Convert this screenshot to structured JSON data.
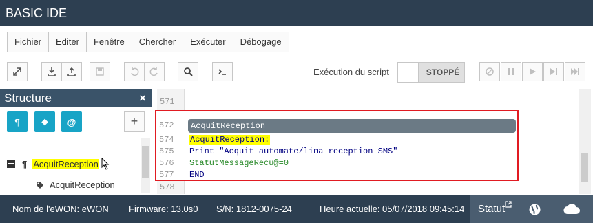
{
  "app": {
    "title": "BASIC IDE"
  },
  "menu": [
    "Fichier",
    "Editer",
    "Fenêtre",
    "Chercher",
    "Exécuter",
    "Débogage"
  ],
  "toolbar": {
    "exec_label": "Exécution du script",
    "state": "STOPPÉ"
  },
  "structure": {
    "title": "Structure",
    "close": "×",
    "buttons": [
      "¶",
      "⬥",
      "@"
    ],
    "add": "+",
    "tree": {
      "parent": "AcquitReception",
      "child": "AcquitReception"
    }
  },
  "editor": {
    "bg_lines": [
      "571",
      "572",
      "578"
    ],
    "fold_header": "AcquitReception",
    "lines": [
      {
        "num": "572",
        "code": ""
      },
      {
        "num": "574",
        "code": "AcquitReception:"
      },
      {
        "num": "575",
        "code": "Print \"Acquit automate/lina reception SMS\""
      },
      {
        "num": "576",
        "code": "StatutMessageRecu@=0"
      },
      {
        "num": "577",
        "code": "END"
      },
      {
        "num": "578",
        "code": ""
      }
    ]
  },
  "status": {
    "ewon": "Nom de l'eWON: eWON",
    "firmware": "Firmware: 13.0s0",
    "sn": "S/N: 1812-0075-24",
    "heure": "Heure actuelle: 05/07/2018 09:45:14",
    "statut": "Statut"
  },
  "colors": {
    "accent": "#18a4c6",
    "header": "#2d3f51",
    "highlight": "#ffff00",
    "border_red": "#e11b22"
  }
}
